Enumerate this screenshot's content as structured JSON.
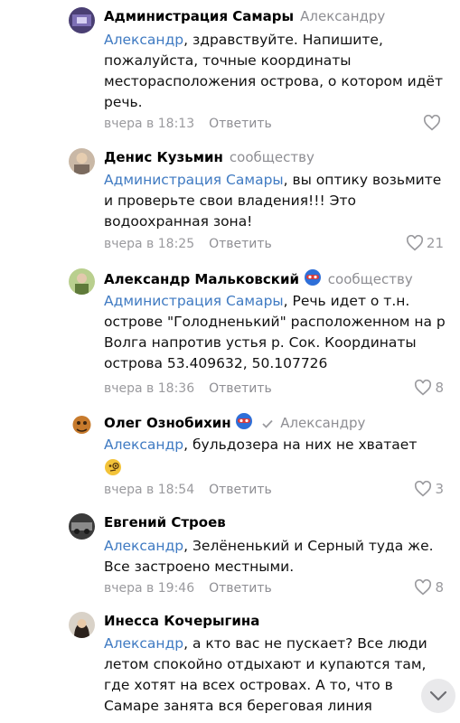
{
  "comments": [
    {
      "author": "Администрация Самары",
      "reply_to": "Александру",
      "mention": "Александр",
      "text": ", здравствуйте. Напишите, пожалуйста, точные координаты месторасположения острова, о котором идёт речь.",
      "time": "вчера в 18:13",
      "reply_label": "Ответить",
      "likes": ""
    },
    {
      "author": "Денис Кузьмин",
      "reply_to": "сообществу",
      "mention": "Администрация Самары",
      "text": ",  вы оптику возьмите и проверьте свои владения!!! Это водоохранная зона!",
      "time": "вчера в 18:25",
      "reply_label": "Ответить",
      "likes": "21"
    },
    {
      "author": "Александр Мальковский",
      "reply_to": "сообществу",
      "mention": "Администрация Самары",
      "text": ", Речь идет о т.н. острове \"Голодненький\" расположенном на р Волга напротив устья р. Сок. Координаты острова 53.409632, 50.107726",
      "time": "вчера в 18:36",
      "reply_label": "Ответить",
      "likes": "8"
    },
    {
      "author": "Олег Ознобихин",
      "reply_to": "Александру",
      "mention": "Александр",
      "text": ", бульдозера на них не хватает",
      "time": "вчера в 18:54",
      "reply_label": "Ответить",
      "likes": "3"
    },
    {
      "author": "Евгений Строев",
      "reply_to": "",
      "mention": "Александр",
      "text": ", Зелёненький и Серный туда же. Все застроено местными.",
      "time": "вчера в 19:46",
      "reply_label": "Ответить",
      "likes": "8"
    },
    {
      "author": "Инесса Кочерыгина",
      "reply_to": "",
      "mention": "Александр",
      "text": ", а кто вас не пускает?  Все люди летом спокойно отдыхают и купаются там, где хотят на всех островах.  А то, что в Самаре занята вся береговая линия",
      "time": "",
      "reply_label": "",
      "likes": ""
    }
  ],
  "icons": {
    "like": "heart-icon",
    "scroll": "chevron-down-icon",
    "verified": "checkmark-icon",
    "badge": "superhero-mask-emoji",
    "thinking": "monocle-face-emoji"
  },
  "colors": {
    "accent": "#3f7ac2",
    "muted": "#9a9a9e"
  }
}
